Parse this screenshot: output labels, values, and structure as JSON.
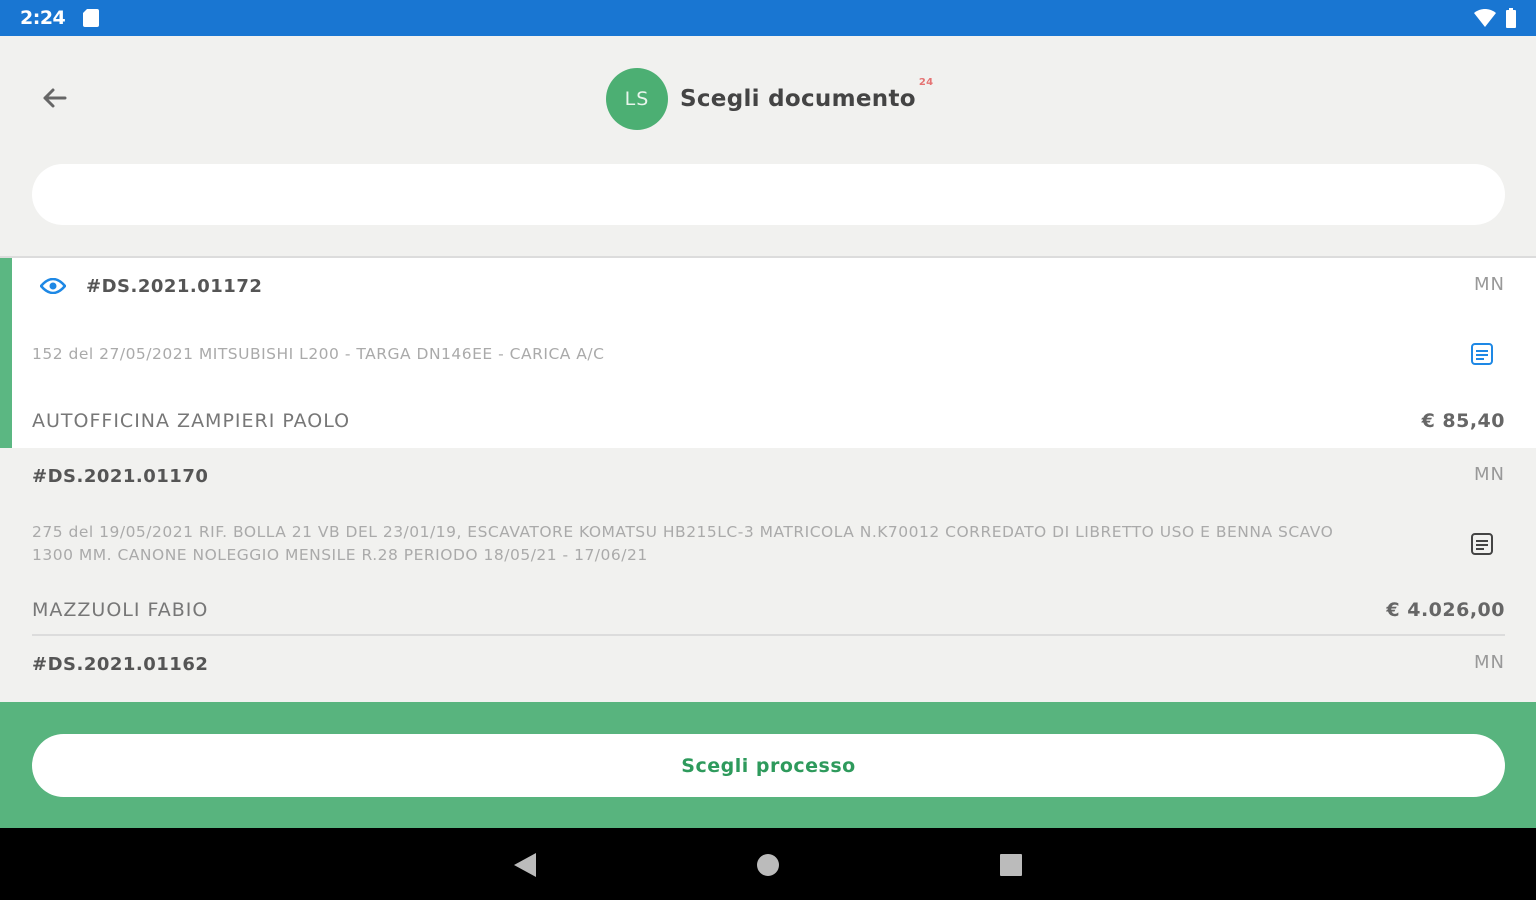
{
  "status_bar": {
    "time": "2:24"
  },
  "header": {
    "avatar_initials": "LS",
    "title": "Scegli documento",
    "title_badge": "24"
  },
  "search": {
    "value": "",
    "placeholder": ""
  },
  "documents": [
    {
      "id": "#DS.2021.01172",
      "code": "MN",
      "description": "152 del 27/05/2021 MITSUBISHI L200 - TARGA DN146EE - CARICA A/C",
      "client": "AUTOFFICINA ZAMPIERI PAOLO",
      "amount": "€ 85,40",
      "selected": true
    },
    {
      "id": "#DS.2021.01170",
      "code": "MN",
      "description": "275 del 19/05/2021 RIF. BOLLA        21 VB DEL 23/01/19, ESCAVATORE KOMATSU HB215LC-3 MATRICOLA N.K70012 CORREDATO DI LIBRETTO USO E BENNA SCAVO 1300 MM. CANONE NOLEGGIO MENSILE R.28 PERIODO 18/05/21 - 17/06/21",
      "client": "MAZZUOLI FABIO",
      "amount": "€ 4.026,00",
      "selected": false
    },
    {
      "id": "#DS.2021.01162",
      "code": "MN",
      "selected": false
    }
  ],
  "footer": {
    "button_label": "Scegli processo"
  },
  "colors": {
    "status_bar": "#1976d2",
    "accent_green": "#58b47e",
    "avatar_green": "#4caf73",
    "icon_blue": "#1e88e5"
  }
}
